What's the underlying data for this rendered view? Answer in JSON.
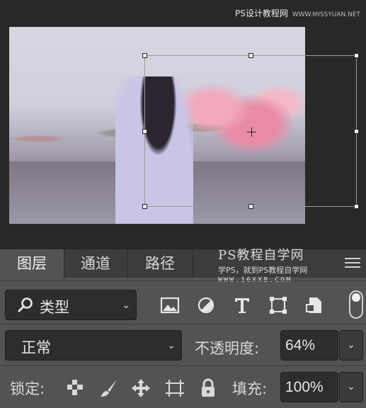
{
  "watermark_top": {
    "text": "PS设计教程网",
    "sub": "WWW.MISSYUAN.NET"
  },
  "tabs": [
    {
      "label": "图层",
      "active": true
    },
    {
      "label": "通道",
      "active": false
    },
    {
      "label": "路径",
      "active": false
    }
  ],
  "watermark_mid": {
    "line1": "PS教程自学网",
    "line2": "学PS，就到PS教程自学网",
    "line3": "WWW.16XX8.COM"
  },
  "filter": {
    "label": "类型",
    "icons": [
      "image-filter-icon",
      "adjustment-filter-icon",
      "type-filter-icon",
      "shape-filter-icon",
      "smart-object-filter-icon"
    ]
  },
  "blend_mode": {
    "value": "正常"
  },
  "opacity": {
    "label": "不透明度:",
    "value": "64%"
  },
  "lock": {
    "label": "锁定:",
    "icons": [
      "lock-transparent-icon",
      "lock-brush-icon",
      "lock-position-icon",
      "lock-artboard-icon",
      "lock-all-icon"
    ]
  },
  "fill": {
    "label": "填充:",
    "value": "100%"
  }
}
